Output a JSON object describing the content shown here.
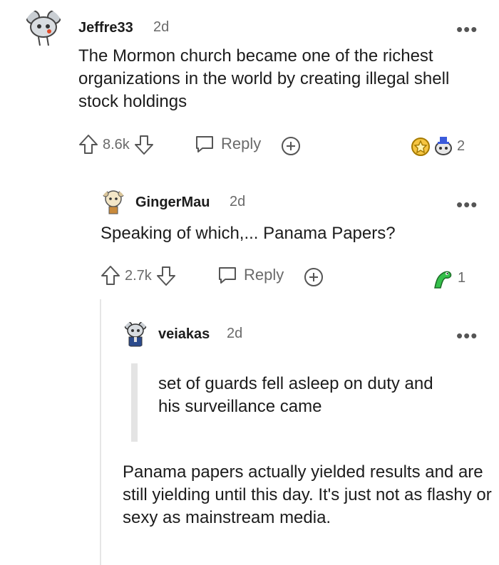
{
  "comments": [
    {
      "username": "Jeffre33",
      "age": "2d",
      "text": "The Mormon church became one of the richest organizations in the world by creating illegal shell stock holdings",
      "votes": "8.6k",
      "reply_label": "Reply",
      "awards_count": "2"
    },
    {
      "username": "GingerMau",
      "age": "2d",
      "text": "Speaking of which,... Panama Papers?",
      "votes": "2.7k",
      "reply_label": "Reply",
      "awards_count": "1"
    },
    {
      "username": "veiakas",
      "age": "2d",
      "quote": "set of guards fell asleep on duty and his surveillance came",
      "text": "Panama papers actually yielded results and are still yielding until this day. It's just not as flashy or sexy as mainstream media."
    }
  ],
  "more_label": "•••",
  "icons": [
    "snoo-avatar-icon",
    "upvote-icon",
    "downvote-icon",
    "reply-icon",
    "add-award-icon",
    "award-icon",
    "more-options-icon"
  ]
}
